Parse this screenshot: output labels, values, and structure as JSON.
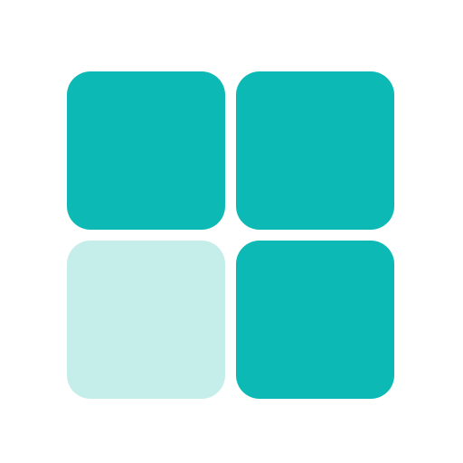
{
  "icon": {
    "name": "grid-apps-icon",
    "tiles": [
      {
        "id": "top-left",
        "color": "#0cb9b4"
      },
      {
        "id": "top-right",
        "color": "#0cb9b4"
      },
      {
        "id": "bottom-left",
        "color": "#c5eeeb"
      },
      {
        "id": "bottom-right",
        "color": "#0cb9b4"
      }
    ],
    "background": "#ffffff"
  }
}
